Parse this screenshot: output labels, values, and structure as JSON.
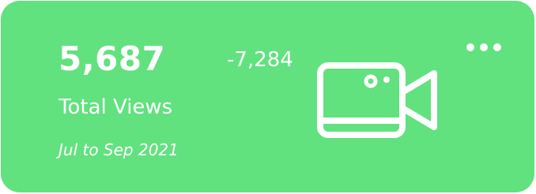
{
  "card": {
    "value": "5,687",
    "delta": "-7,284",
    "label": "Total Views",
    "period": "Jul to Sep 2021",
    "icon": "video-camera-icon",
    "menu_icon": "more-dots-icon",
    "accent_color": "#62e17f",
    "text_color": "#ffffff"
  }
}
